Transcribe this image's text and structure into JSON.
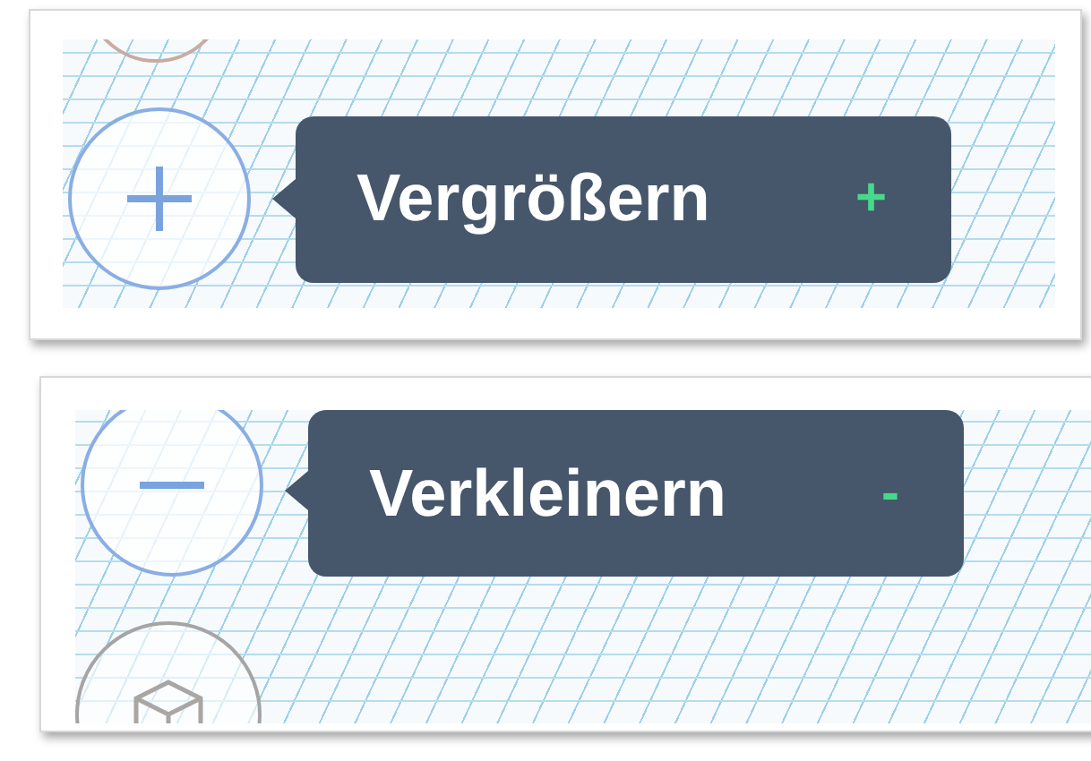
{
  "panels": [
    {
      "buttons": [
        {
          "kind": "arc"
        },
        {
          "kind": "zoom-in",
          "tooltip": {
            "label": "Vergrößern",
            "shortcut": "+"
          }
        }
      ]
    },
    {
      "buttons": [
        {
          "kind": "zoom-out",
          "tooltip": {
            "label": "Verkleinern",
            "shortcut": "-"
          }
        },
        {
          "kind": "cube"
        }
      ]
    }
  ]
}
